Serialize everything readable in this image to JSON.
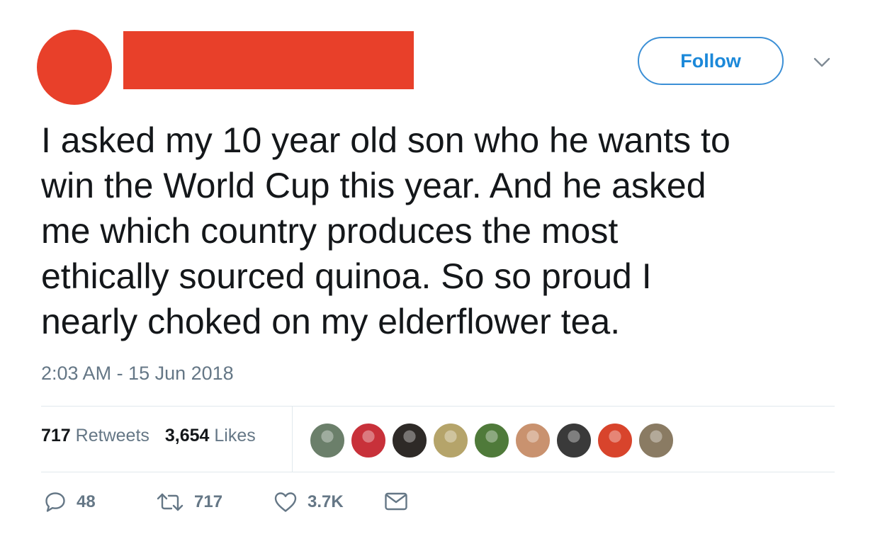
{
  "header": {
    "follow_label": "Follow"
  },
  "tweet": {
    "lines": [
      "I asked my 10 year old son who he wants to",
      "win the World Cup this year. And he asked",
      "me which country produces the most",
      "ethically sourced quinoa. So so proud I",
      "nearly choked on my elderflower tea."
    ],
    "timestamp": "2:03 AM - 15 Jun 2018"
  },
  "stats": {
    "retweets_count": "717",
    "retweets_label": "Retweets",
    "likes_count": "3,654",
    "likes_label": "Likes"
  },
  "likers": [
    {
      "name": "liker-avatar-1",
      "color": "#6b7f6a"
    },
    {
      "name": "liker-avatar-2",
      "color": "#c8313a"
    },
    {
      "name": "liker-avatar-3",
      "color": "#2e2a27"
    },
    {
      "name": "liker-avatar-4",
      "color": "#b5a46a"
    },
    {
      "name": "liker-avatar-5",
      "color": "#4f7a3a"
    },
    {
      "name": "liker-avatar-6",
      "color": "#c9926f"
    },
    {
      "name": "liker-avatar-7",
      "color": "#3a3a3a"
    },
    {
      "name": "liker-avatar-8",
      "color": "#d8442c"
    },
    {
      "name": "liker-avatar-9",
      "color": "#8a7b63"
    }
  ],
  "actions": {
    "reply_count": "48",
    "retweet_count": "717",
    "like_count": "3.7K"
  },
  "colors": {
    "redaction": "#e8402a",
    "accent": "#1b88d9",
    "muted": "#657786"
  },
  "icons": {
    "reply": "speech-bubble-icon",
    "retweet": "retweet-arrows-icon",
    "like": "heart-icon",
    "dm": "envelope-icon",
    "caret": "chevron-down-icon"
  }
}
